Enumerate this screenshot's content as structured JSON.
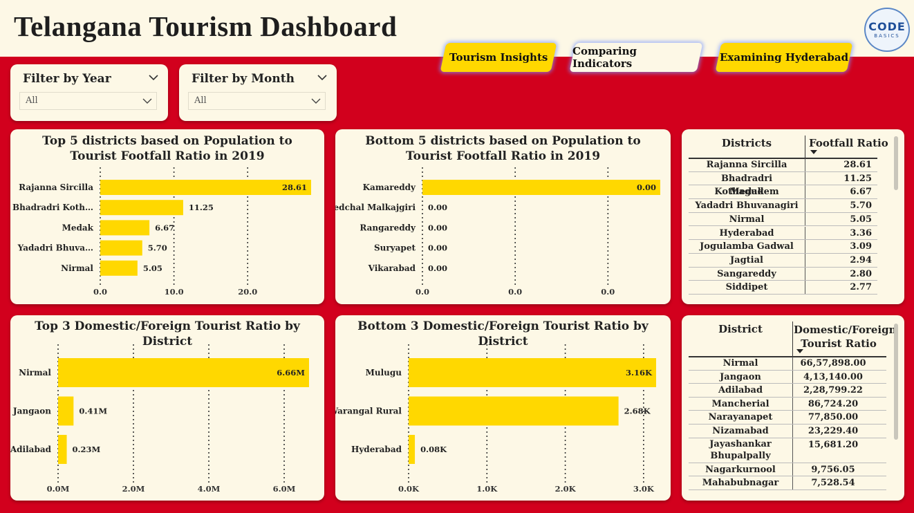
{
  "header": {
    "title": "Telangana Tourism Dashboard",
    "logo_line1": "CODE",
    "logo_line2": "BASICS"
  },
  "tabs": [
    {
      "label": "Tourism Insights"
    },
    {
      "label": "Comparing Indicators"
    },
    {
      "label": "Examining Hyderabad"
    }
  ],
  "filters": {
    "year": {
      "title": "Filter by Year",
      "value": "All"
    },
    "month": {
      "title": "Filter by Month",
      "value": "All"
    }
  },
  "colors": {
    "bar": "#ffd800",
    "background": "#d2001d",
    "panel": "#fdf8e6"
  },
  "chart_data": [
    {
      "type": "bar",
      "orientation": "horizontal",
      "title": "Top 5 districts based on Population to Tourist Footfall Ratio in 2019",
      "categories": [
        "Rajanna Sircilla",
        "Bhadradri Koth…",
        "Medak",
        "Yadadri Bhuva…",
        "Nirmal"
      ],
      "values": [
        28.61,
        11.25,
        6.67,
        5.7,
        5.05
      ],
      "value_labels": [
        "28.61",
        "11.25",
        "6.67",
        "5.70",
        "5.05"
      ],
      "ticks": [
        "0.0",
        "10.0",
        "20.0"
      ],
      "xlim": [
        0,
        28.61
      ]
    },
    {
      "type": "bar",
      "orientation": "horizontal",
      "title": "Bottom 5 districts based on Population to Tourist Footfall Ratio in 2019",
      "categories": [
        "Kamareddy",
        "Medchal Malkajgiri",
        "Rangareddy",
        "Suryapet",
        "Vikarabad"
      ],
      "values": [
        0.0049,
        0.0,
        0.0,
        0.0,
        0.0
      ],
      "value_labels": [
        "0.00",
        "0.00",
        "0.00",
        "0.00",
        "0.00"
      ],
      "ticks": [
        "0.0",
        "0.0",
        "0.0"
      ],
      "xlim": [
        0,
        0.0049
      ]
    },
    {
      "type": "bar",
      "orientation": "horizontal",
      "title": "Top 3 Domestic/Foreign Tourist Ratio by District",
      "categories": [
        "Nirmal",
        "Jangaon",
        "Adilabad"
      ],
      "values": [
        6.66,
        0.41,
        0.23
      ],
      "value_labels": [
        "6.66M",
        "0.41M",
        "0.23M"
      ],
      "ticks": [
        "0.0M",
        "2.0M",
        "4.0M",
        "6.0M"
      ],
      "xlim": [
        0,
        6.66
      ],
      "unit": "M"
    },
    {
      "type": "bar",
      "orientation": "horizontal",
      "title": "Bottom 3 Domestic/Foreign Tourist Ratio by District",
      "categories": [
        "Mulugu",
        "Warangal Rural",
        "Hyderabad"
      ],
      "values": [
        3.16,
        2.68,
        0.08
      ],
      "value_labels": [
        "3.16K",
        "2.68K",
        "0.08K"
      ],
      "ticks": [
        "0.0K",
        "1.0K",
        "2.0K",
        "3.0K"
      ],
      "xlim": [
        0,
        3.16
      ],
      "unit": "K"
    }
  ],
  "table1": {
    "col1": "Districts",
    "col2": "Footfall Ratio",
    "rows": [
      [
        "Rajanna Sircilla",
        "28.61"
      ],
      [
        "Bhadradri Kothagudem",
        "11.25"
      ],
      [
        "Medak",
        "6.67"
      ],
      [
        "Yadadri Bhuvanagiri",
        "5.70"
      ],
      [
        "Nirmal",
        "5.05"
      ],
      [
        "Hyderabad",
        "3.36"
      ],
      [
        "Jogulamba Gadwal",
        "3.09"
      ],
      [
        "Jagtial",
        "2.94"
      ],
      [
        "Sangareddy",
        "2.80"
      ],
      [
        "Siddipet",
        "2.77"
      ]
    ]
  },
  "table2": {
    "col1": "District",
    "col2": "Domestic/Foreign Tourist Ratio",
    "rows": [
      [
        "Nirmal",
        "66,57,898.00"
      ],
      [
        "Jangaon",
        "4,13,140.00"
      ],
      [
        "Adilabad",
        "2,28,799.22"
      ],
      [
        "Mancherial",
        "86,724.20"
      ],
      [
        "Narayanapet",
        "77,850.00"
      ],
      [
        "Nizamabad",
        "23,229.40"
      ],
      [
        "Jayashankar Bhupalpally",
        "15,681.20"
      ],
      [
        "Nagarkurnool",
        "9,756.05"
      ],
      [
        "Mahabubnagar",
        "7,528.54"
      ]
    ]
  }
}
